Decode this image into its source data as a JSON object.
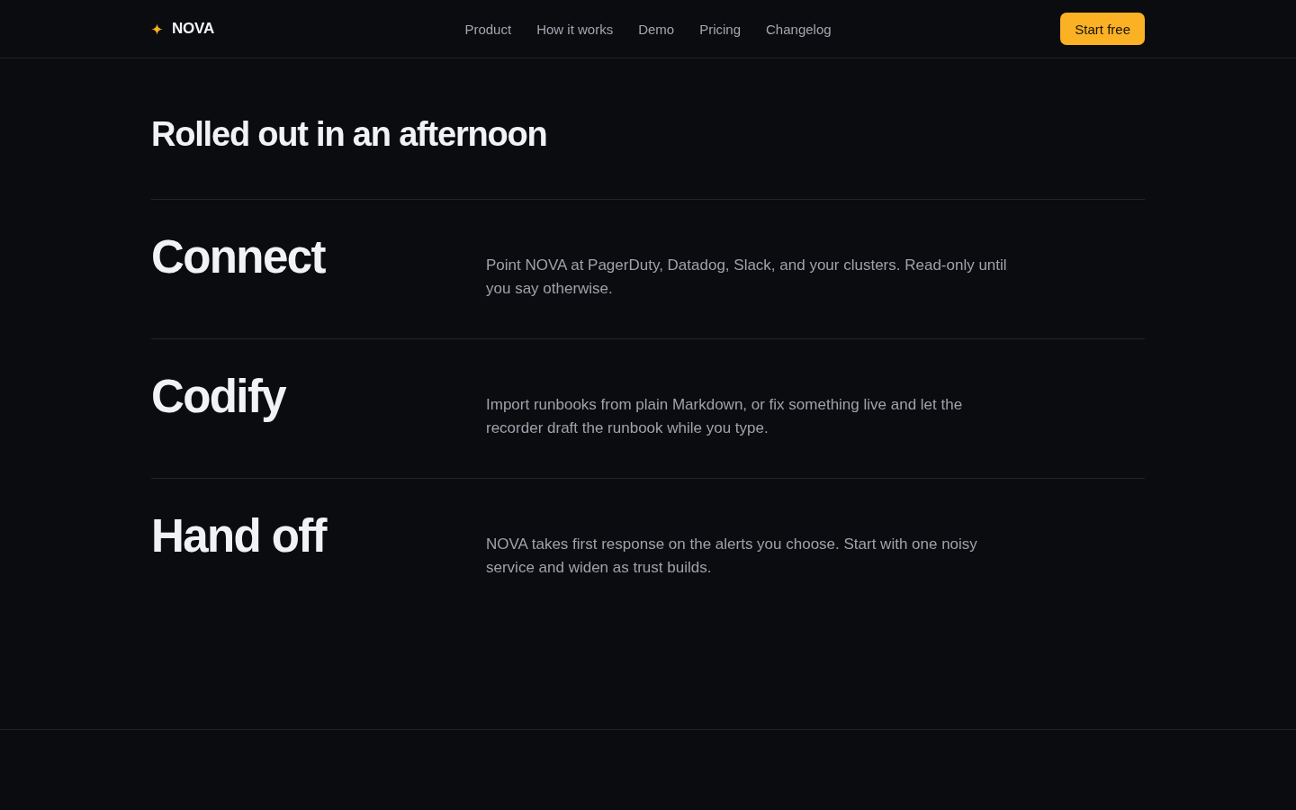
{
  "header": {
    "brand": "NOVA",
    "nav": [
      {
        "label": "Product"
      },
      {
        "label": "How it works"
      },
      {
        "label": "Demo"
      },
      {
        "label": "Pricing"
      },
      {
        "label": "Changelog"
      }
    ],
    "cta": "Start free"
  },
  "section": {
    "title": "Rolled out in an afternoon",
    "steps": [
      {
        "title": "Connect",
        "description": "Point NOVA at PagerDuty, Datadog, Slack, and your clusters. Read-only until you say otherwise."
      },
      {
        "title": "Codify",
        "description": "Import runbooks from plain Markdown, or fix something live and let the recorder draft the runbook while you type."
      },
      {
        "title": "Hand off",
        "description": "NOVA takes first response on the alerts you choose. Start with one noisy service and widen as trust builds."
      }
    ]
  }
}
